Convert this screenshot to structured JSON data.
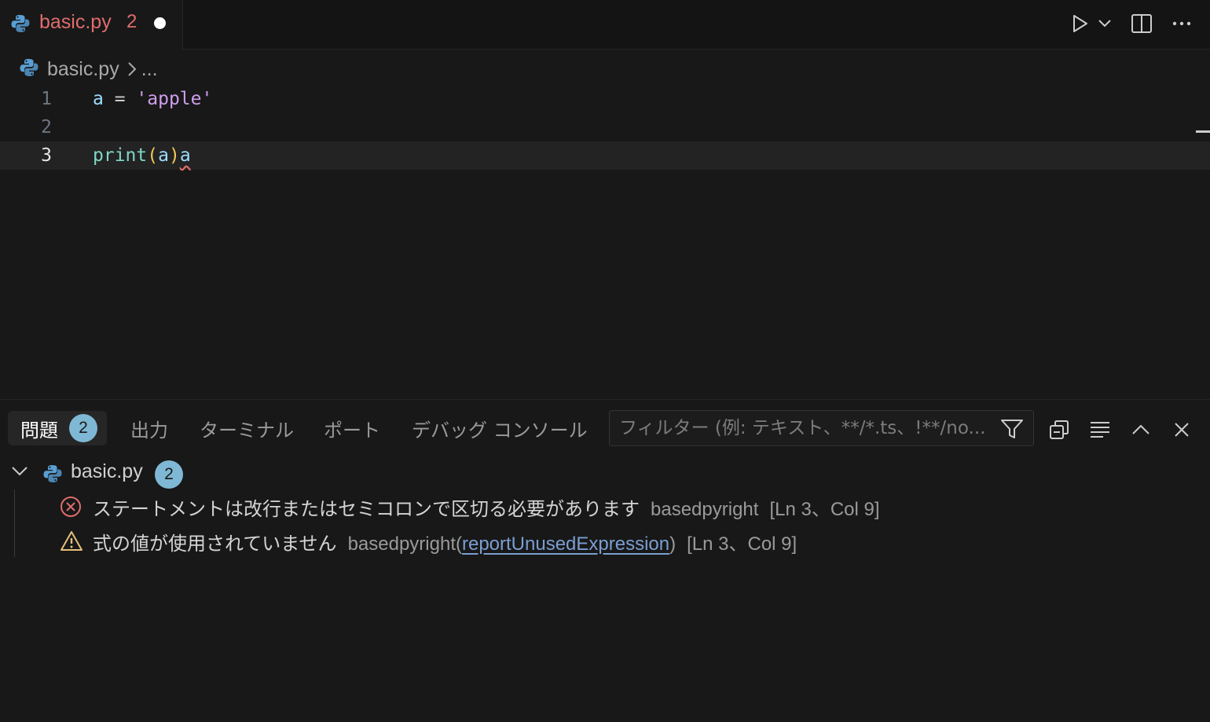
{
  "tab": {
    "file_name": "basic.py",
    "problem_count": "2",
    "unsaved": true
  },
  "breadcrumb": {
    "file": "basic.py",
    "rest": "..."
  },
  "editor": {
    "current_line": 3,
    "lines": [
      {
        "number": "1",
        "tokens": [
          "a",
          " = ",
          "'apple'"
        ]
      },
      {
        "number": "2",
        "tokens": []
      },
      {
        "number": "3",
        "tokens": [
          "print",
          "(",
          "a",
          ")",
          "a"
        ]
      }
    ]
  },
  "panel": {
    "tabs": {
      "problems": "問題",
      "problems_count": "2",
      "output": "出力",
      "terminal": "ターミナル",
      "ports": "ポート",
      "debug_console": "デバッグ コンソール"
    },
    "filter_placeholder": "フィルター (例: テキスト、**/*.ts、!**/no...",
    "file": {
      "name": "basic.py",
      "count": "2"
    },
    "diagnostics": [
      {
        "severity": "error",
        "message": "ステートメントは改行またはセミコロンで区切る必要があります",
        "source": "basedpyright",
        "code": "",
        "location": "[Ln 3、Col 9]"
      },
      {
        "severity": "warning",
        "message": "式の値が使用されていません",
        "source": "basedpyright(",
        "code": "reportUnusedExpression",
        "source_close": ")",
        "location": "[Ln 3、Col 9]"
      }
    ]
  },
  "colors": {
    "background": "#181818",
    "error": "#e06c6c",
    "warning": "#e5c07b",
    "badge": "#7fb8d4"
  },
  "icons": [
    "python-file-icon",
    "run-icon",
    "chevron-down-icon",
    "split-editor-icon",
    "more-icon",
    "chevron-right-icon",
    "filter-icon",
    "collapse-all-icon",
    "word-wrap-icon",
    "maximize-panel-icon",
    "close-icon",
    "error-icon",
    "warning-icon"
  ]
}
